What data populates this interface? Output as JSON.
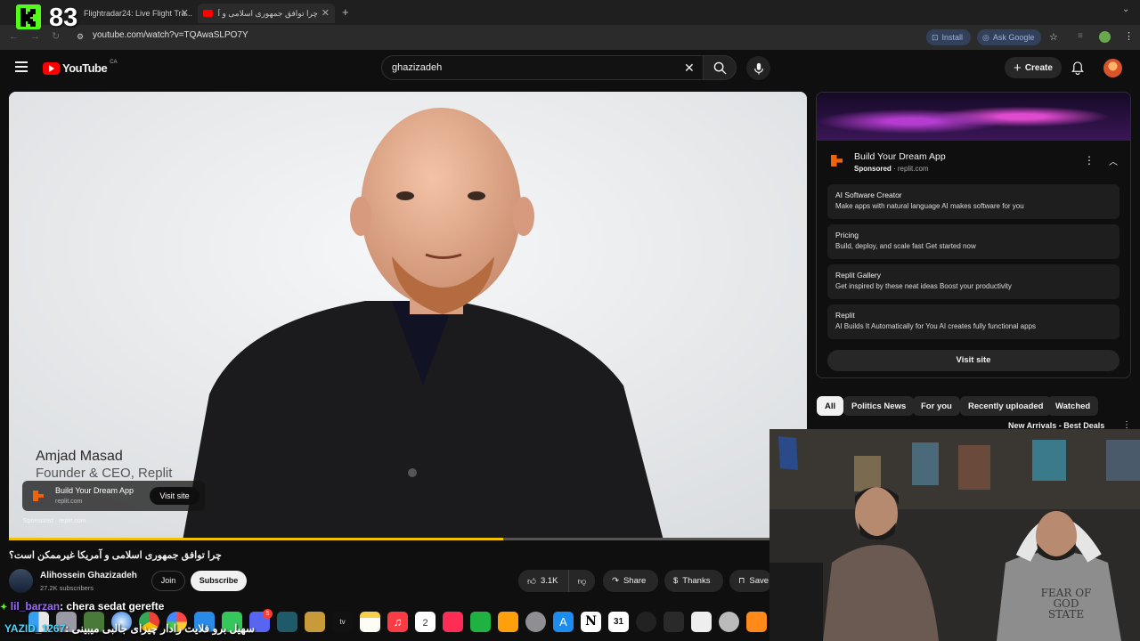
{
  "stream_overlay": {
    "viewer_count": "83",
    "chat": [
      {
        "user": "lil_barzan",
        "message": ": chera sedat gerefte"
      },
      {
        "user": "YAZID_1267",
        "message": ": سهیل برو فلایت رادار چیزای جالبی میبینی"
      }
    ]
  },
  "browser": {
    "tabs": [
      {
        "title": "Flightradar24: Live Flight Tra..."
      },
      {
        "title": "چرا توافق جمهوری اسلامی و آمریکا..."
      }
    ],
    "url": "youtube.com/watch?v=TQAwaSLPO7Y",
    "install_label": "Install",
    "ask_google_label": "Ask Google"
  },
  "youtube": {
    "logo_text": "YouTube",
    "region": "CA",
    "search_value": "ghazizadeh",
    "create_label": "Create"
  },
  "video": {
    "lower_third_name": "Amjad Masad",
    "lower_third_title": "Founder & CEO, Replit",
    "ad_title": "Build Your Dream App",
    "ad_domain": "replit.com",
    "visit_site_label": "Visit site",
    "sponsored_text": "Sponsored",
    "sponsored_domain": "replit.com",
    "progress_fraction": 0.65,
    "title": "چرا توافق جمهوری اسلامی و آمریکا غیرممکن است؟"
  },
  "channel": {
    "name": "Alihossein Ghazizadeh",
    "subscribers": "27.2K subscribers",
    "join_label": "Join",
    "subscribe_label": "Subscribe"
  },
  "actions": {
    "likes": "3.1K",
    "share_label": "Share",
    "thanks_label": "Thanks",
    "save_label": "Save"
  },
  "sidebar_ad": {
    "title": "Build Your Dream App",
    "sponsored": "Sponsored",
    "domain": "replit.com",
    "items": [
      {
        "title": "AI Software Creator",
        "desc": "Make apps with natural language AI makes software for you"
      },
      {
        "title": "Pricing",
        "desc": "Build, deploy, and scale fast Get started now"
      },
      {
        "title": "Replit Gallery",
        "desc": "Get inspired by these neat ideas Boost your productivity"
      },
      {
        "title": "Replit",
        "desc": "AI Builds It Automatically for You AI creates fully functional apps"
      }
    ],
    "visit_site_label": "Visit site"
  },
  "chips": [
    "All",
    "Politics News",
    "For you",
    "Recently uploaded",
    "Watched"
  ],
  "next_item_title": "New Arrivals - Best Deals",
  "webcam": {
    "hoodie_text": "FEAR OF GOD\nSTATE"
  },
  "dock": {
    "calendar_day": "31",
    "notification_badge": "5"
  },
  "colors": {
    "youtube_red": "#ff0000",
    "progress": "#f2c200",
    "kick_green": "#53fc18",
    "link_blue": "#9fb4d9"
  }
}
